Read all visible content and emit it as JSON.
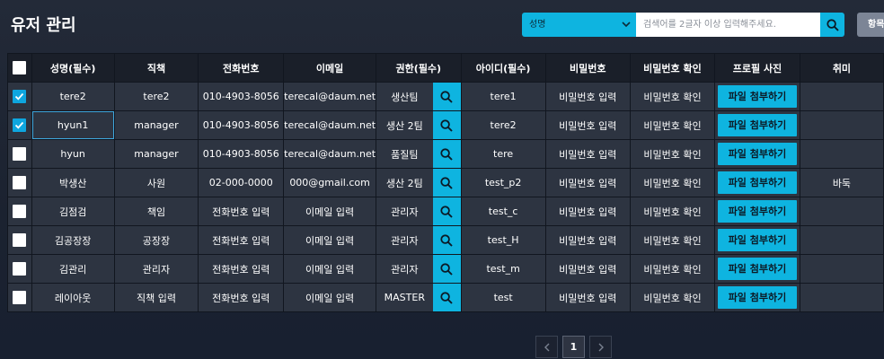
{
  "page": {
    "title": "유저 관리"
  },
  "search": {
    "select_value": "성명",
    "placeholder": "검색어를 2글자 이상 입력해주세요.",
    "extra_button_label": "항목"
  },
  "columns": [
    "성명(필수)",
    "직책",
    "전화번호",
    "이메일",
    "권한(필수)",
    "아이디(필수)",
    "비밀번호",
    "비밀번호 확인",
    "프로필 사진",
    "취미"
  ],
  "rows": [
    {
      "checked": true,
      "name": "tere2",
      "position": "tere2",
      "phone": "010-4903-8056",
      "email": "terecal@daum.net",
      "auth": "생산팀",
      "id": "tere1",
      "password": "비밀번호 입력",
      "password_confirm": "비밀번호 확인",
      "file": "파일 첨부하기",
      "hobby": ""
    },
    {
      "checked": true,
      "name": "hyun1",
      "position": "manager",
      "phone": "010-4903-8056",
      "email": "terecal@daum.net",
      "auth": "생산 2팀",
      "id": "tere2",
      "password": "비밀번호 입력",
      "password_confirm": "비밀번호 확인",
      "file": "파일 첨부하기",
      "hobby": ""
    },
    {
      "checked": false,
      "name": "hyun",
      "position": "manager",
      "phone": "010-4903-8056",
      "email": "terecal@daum.net",
      "auth": "품질팀",
      "id": "tere",
      "password": "비밀번호 입력",
      "password_confirm": "비밀번호 확인",
      "file": "파일 첨부하기",
      "hobby": ""
    },
    {
      "checked": false,
      "name": "박생산",
      "position": "사원",
      "phone": "02-000-0000",
      "email": "000@gmail.com",
      "auth": "생산 2팀",
      "id": "test_p2",
      "password": "비밀번호 입력",
      "password_confirm": "비밀번호 확인",
      "file": "파일 첨부하기",
      "hobby": "바둑"
    },
    {
      "checked": false,
      "name": "김점검",
      "position": "책임",
      "phone": "전화번호 입력",
      "email": "이메일 입력",
      "auth": "관리자",
      "id": "test_c",
      "password": "비밀번호 입력",
      "password_confirm": "비밀번호 확인",
      "file": "파일 첨부하기",
      "hobby": ""
    },
    {
      "checked": false,
      "name": "김공장장",
      "position": "공장장",
      "phone": "전화번호 입력",
      "email": "이메일 입력",
      "auth": "관리자",
      "id": "test_H",
      "password": "비밀번호 입력",
      "password_confirm": "비밀번호 확인",
      "file": "파일 첨부하기",
      "hobby": ""
    },
    {
      "checked": false,
      "name": "김관리",
      "position": "관리자",
      "phone": "전화번호 입력",
      "email": "이메일 입력",
      "auth": "관리자",
      "id": "test_m",
      "password": "비밀번호 입력",
      "password_confirm": "비밀번호 확인",
      "file": "파일 첨부하기",
      "hobby": ""
    },
    {
      "checked": false,
      "name": "레이아웃",
      "position": "직책 입력",
      "phone": "전화번호 입력",
      "email": "이메일 입력",
      "auth": "MASTER",
      "id": "test",
      "password": "비밀번호 입력",
      "password_confirm": "비밀번호 확인",
      "file": "파일 첨부하기",
      "hobby": ""
    }
  ],
  "placeholder_values": [
    "직책 입력",
    "전화번호 입력",
    "이메일 입력",
    "비밀번호 입력",
    "비밀번호 확인"
  ],
  "pagination": {
    "current": "1",
    "prev_icon": "chevron-left-icon",
    "next_icon": "chevron-right-icon"
  },
  "colors": {
    "accent": "#0eb4e0",
    "row_bg": "#2d3441",
    "header_bg": "#1a1f29"
  }
}
